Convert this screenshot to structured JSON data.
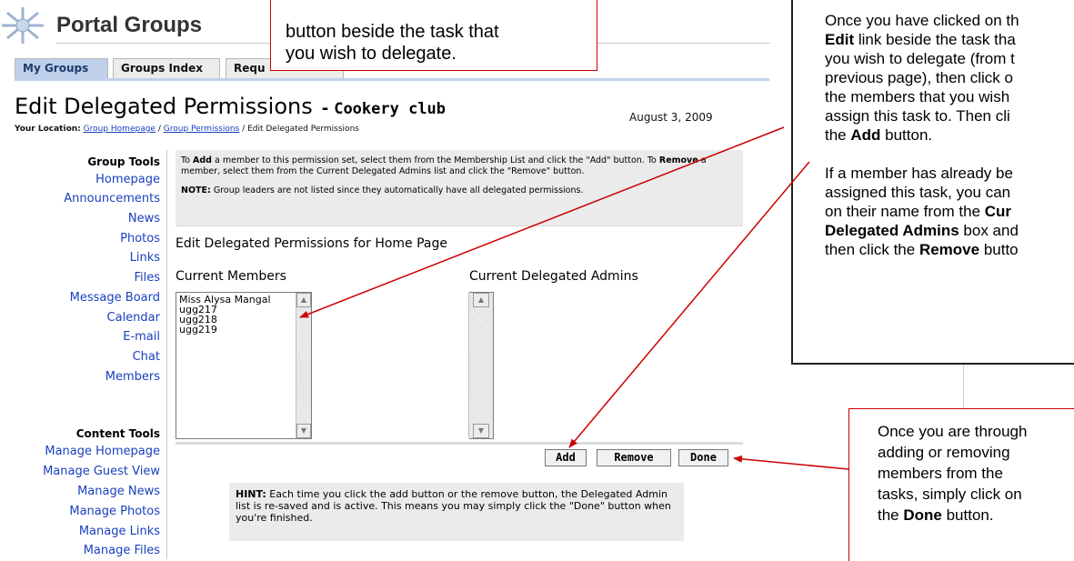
{
  "header": {
    "title": "Portal Groups"
  },
  "tabs": [
    {
      "label": "My Groups"
    },
    {
      "label": "Groups Index"
    },
    {
      "label": "Requ"
    }
  ],
  "page": {
    "title": "Edit Delegated Permissions",
    "separator": "-",
    "group_name": "Cookery club",
    "date": "August 3, 2009",
    "breadcrumb": {
      "label": "Your Location:",
      "items": [
        "Group Homepage",
        "Group Permissions",
        "Edit Delegated Permissions"
      ],
      "separator": "/"
    }
  },
  "sidebar": {
    "group_tools_heading": "Group Tools",
    "group_tools": [
      "Homepage",
      "Announcements",
      "News",
      "Photos",
      "Links",
      "Files",
      "Message Board",
      "Calendar",
      "E-mail",
      "Chat",
      "Members"
    ],
    "content_tools_heading": "Content Tools",
    "content_tools": [
      "Manage Homepage",
      "Manage Guest View",
      "Manage News",
      "Manage Photos",
      "Manage Links",
      "Manage Files"
    ]
  },
  "info": {
    "instructions": {
      "t1": "To ",
      "b1": "Add",
      "t2": " a member to this permission set, select them from the Membership List and click the \"Add\" button. To ",
      "b2": "Remove",
      "t3": " a member, select them from the Current Delegated Admins list and click the \"Remove\" button."
    },
    "note_label": "NOTE:",
    "note_text": " Group leaders are not listed since they automatically have all delegated permissions."
  },
  "permission_heading": "Edit Delegated Permissions for Home Page",
  "members": {
    "label": "Current Members",
    "items": [
      "Miss Alysa Mangal",
      "ugg217",
      "ugg218",
      "ugg219"
    ]
  },
  "admins": {
    "label": "Current Delegated Admins",
    "items": []
  },
  "buttons": {
    "add": "Add",
    "remove": "Remove",
    "done": "Done"
  },
  "hint": {
    "label": "HINT:",
    "text": " Each time you click the add button or the remove button, the Delegated Admin list is re-saved and is active. This means you may simply click the \"Done\" button when you're finished."
  },
  "callouts": {
    "top": {
      "lines": [
        "button beside the task that",
        "you wish to delegate."
      ]
    },
    "right": {
      "p1": {
        "l1": "Once you have clicked on th",
        "l2_bold": "Edit",
        "l2_rest": " link beside the task tha",
        "l3": "you wish to delegate (from t",
        "l4": "previous page), then click o",
        "l5": "the members that you wish",
        "l6": "assign this task to. Then cli",
        "l7_pre": "the ",
        "l7_bold": "Add",
        "l7_rest": " button."
      },
      "p2": {
        "l1": "If a member has already be",
        "l2": "assigned this task, you can",
        "l3_pre": "on their name from the ",
        "l3_bold": "Cur",
        "l4_bold": "Delegated Admins",
        "l4_rest": " box and",
        "l5_pre": "then click the ",
        "l5_bold": "Remove",
        "l5_rest": " butto"
      }
    },
    "bottom": {
      "l1": "Once you are through",
      "l2": "adding or removing",
      "l3": "members from the",
      "l4": "tasks, simply click on",
      "l5_pre": "the ",
      "l5_bold": "Done",
      "l5_rest": " button."
    }
  },
  "colors": {
    "callout_border": "#cc0000",
    "link": "#1a3fbf",
    "tab_active": "#bfd1ea",
    "panel": "#ebebeb"
  }
}
